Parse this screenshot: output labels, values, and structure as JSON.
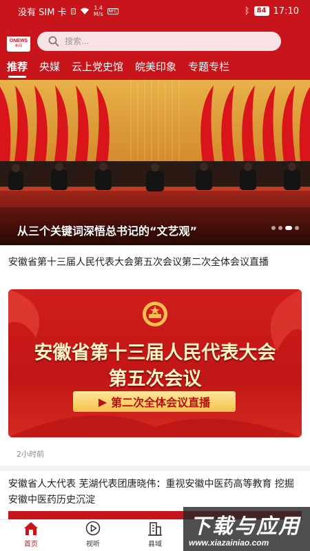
{
  "status_bar": {
    "carrier": "没有 SIM 卡",
    "net_speed_value": "1.4",
    "net_speed_unit": "M/s",
    "battery": "84",
    "time": "17:10"
  },
  "app": {
    "logo_text": "ONEWS",
    "logo_subtext": "新闻"
  },
  "search": {
    "placeholder": "搜索..."
  },
  "tabs": [
    {
      "label": "推荐",
      "active": true
    },
    {
      "label": "央媒"
    },
    {
      "label": "云上党史馆"
    },
    {
      "label": "皖美印象"
    },
    {
      "label": "专题专栏"
    }
  ],
  "hero": {
    "caption": "从三个关键词深悟总书记的“文艺观”",
    "slide_count": 4,
    "active_slide": 3
  },
  "articles": [
    {
      "title": "安徽省第十三届人民代表大会第五次会议第二次全体会议直播",
      "card_line1": "安徽省第十三届人民代表大会",
      "card_line2": "第五次会议",
      "card_button": "第二次全体会议直播",
      "time": "2小时前"
    },
    {
      "title": "安徽省人大代表 芜湖代表团唐晓伟：重视安徽中医药高等教育 挖掘安徽中医药历史沉淀"
    }
  ],
  "watermark": {
    "main": "下载与应用",
    "url": "www.xiazainiao.com"
  },
  "bottom_nav": [
    {
      "label": "首页",
      "icon": "home-icon",
      "active": true
    },
    {
      "label": "视听",
      "icon": "play-icon"
    },
    {
      "label": "县域",
      "icon": "building-icon"
    }
  ],
  "colors": {
    "brand_red": "#c8141b",
    "gold_text": "#fff6c9"
  }
}
